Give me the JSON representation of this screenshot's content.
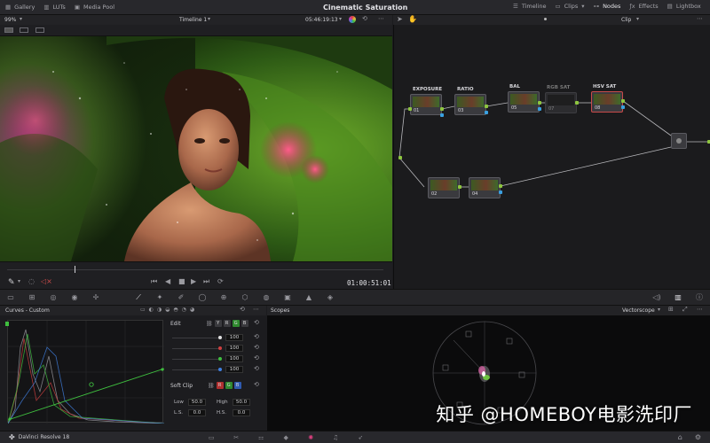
{
  "topbar": {
    "items_left": [
      {
        "icon": "gallery-icon",
        "label": "Gallery"
      },
      {
        "icon": "luts-icon",
        "label": "LUTs"
      },
      {
        "icon": "media-pool-icon",
        "label": "Media Pool"
      }
    ],
    "title": "Cinematic Saturation",
    "items_right": [
      {
        "icon": "timeline-icon",
        "label": "Timeline"
      },
      {
        "icon": "clips-icon",
        "label": "Clips"
      },
      {
        "icon": "nodes-icon",
        "label": "Nodes"
      },
      {
        "icon": "effects-icon",
        "label": "Effects"
      },
      {
        "icon": "lightbox-icon",
        "label": "Lightbox"
      }
    ]
  },
  "viewer": {
    "zoom": "99%",
    "timeline_name": "Timeline 1",
    "timecode_top": "05:46:19:13",
    "timecode": "01:00:51:01"
  },
  "node_editor": {
    "mode": "Clip",
    "nodes": [
      {
        "label": "EXPOSURE",
        "num": "01",
        "enabled": true
      },
      {
        "label": "RATIO",
        "num": "03",
        "enabled": true
      },
      {
        "label": "BAL",
        "num": "05",
        "enabled": true
      },
      {
        "label": "RGB SAT",
        "num": "07",
        "enabled": false
      },
      {
        "label": "HSV SAT",
        "num": "08",
        "enabled": true
      },
      {
        "label": "",
        "num": "02",
        "enabled": true
      },
      {
        "label": "",
        "num": "04",
        "enabled": true
      }
    ]
  },
  "curves": {
    "title": "Curves - Custom",
    "edit_label": "Edit",
    "channels": [
      "Y",
      "R",
      "G",
      "B"
    ],
    "values": [
      "100",
      "100",
      "100",
      "100"
    ],
    "soft_clip_label": "Soft Clip",
    "low_label": "Low",
    "low_value": "50.0",
    "high_label": "High",
    "high_value": "50.0",
    "ls_label": "L.S.",
    "ls_value": "0.0",
    "hs_label": "H.S.",
    "hs_value": "0.0"
  },
  "scopes": {
    "title": "Scopes",
    "mode": "Vectorscope"
  },
  "bottombar": {
    "app_name": "DaVinci Resolve 18"
  },
  "watermark": "知乎 @HOMEBOY电影洗印厂",
  "colors": {
    "accent_red": "#c94a4a",
    "pin_green": "#8ec63f",
    "pin_blue": "#3aa0e0",
    "curve_green": "#3fbf3f"
  }
}
